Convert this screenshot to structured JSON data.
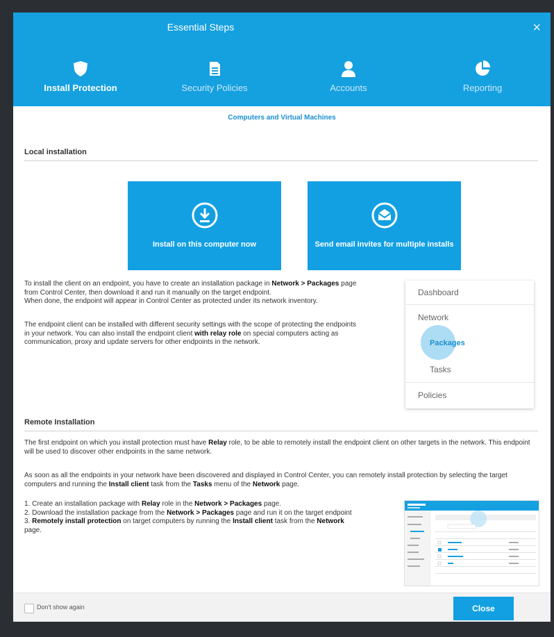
{
  "header": {
    "title": "Essential Steps",
    "close_glyph": "×",
    "steps": [
      {
        "label": "Install Protection",
        "icon": "shield-icon",
        "active": true
      },
      {
        "label": "Security Policies",
        "icon": "document-icon",
        "active": false
      },
      {
        "label": "Accounts",
        "icon": "user-icon",
        "active": false
      },
      {
        "label": "Reporting",
        "icon": "pie-chart-icon",
        "active": false
      }
    ]
  },
  "subtitle": "Computers and Virtual Machines",
  "local": {
    "heading": "Local installation",
    "btn_install": "Install on this computer now",
    "btn_email": "Send email invites for multiple installs",
    "p1_a": "To install the client on an endpoint, you have to create an installation package in ",
    "p1_b": "Network > Packages",
    "p1_c": " page from Control Center, then download it and run it manually on the target endpoint.",
    "p2": "When done, the endpoint will appear in Control Center as protected under its network inventory.",
    "p3_a": "The endpoint client can be installed with different security settings with the scope of protecting the endpoints in your network. You can also install the endpoint client ",
    "p3_b": "with relay role",
    "p3_c": " on special computers acting as communication, proxy and update servers for other endpoints in the network."
  },
  "nav_card": {
    "dashboard": "Dashboard",
    "network": "Network",
    "packages": "Packages",
    "tasks": "Tasks",
    "policies": "Policies"
  },
  "remote": {
    "heading": "Remote Installation",
    "p1_a": "The first endpoint on which you install protection must have ",
    "p1_b": "Relay",
    "p1_c": " role, to be able to remotely install the endpoint client on other targets in the network. This endpoint will be used to discover other endpoints in the same network.",
    "p2_a": "As soon as all the endpoints in your network have been discovered and displayed in Control Center, you can remotely install protection by selecting the target computers and running the ",
    "p2_b": "Install client",
    "p2_c": " task from the ",
    "p2_d": "Tasks",
    "p2_e": " menu of the ",
    "p2_f": "Network",
    "p2_g": " page.",
    "s1_a": "1. Create an installation package with ",
    "s1_b": "Relay",
    "s1_c": " role in the ",
    "s1_d": "Network > Packages",
    "s1_e": " page.",
    "s2_a": "2. Download the installation package from the ",
    "s2_b": "Network > Packages",
    "s2_c": " page and run it on the target endpoint",
    "s3_a": "3. ",
    "s3_b": "Remotely install protection",
    "s3_c": " on target computers by running the ",
    "s3_d": "Install client",
    "s3_e": " task from the ",
    "s3_f": "Network",
    "s3_g": " page."
  },
  "footer": {
    "dont_show": "Don't show again",
    "close": "Close"
  },
  "colors": {
    "accent": "#15a0e0",
    "backdrop": "#2b2f33"
  }
}
